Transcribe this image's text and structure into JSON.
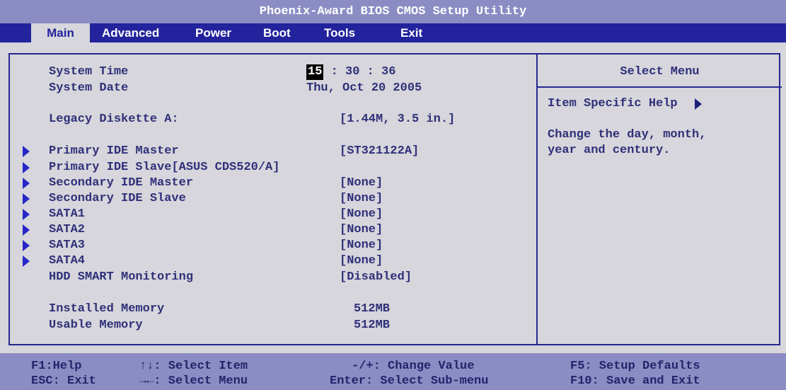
{
  "title": "Phoenix-Award BIOS CMOS Setup Utility",
  "menu": [
    "Main",
    "Advanced",
    "Power",
    "Boot",
    "Tools",
    "Exit"
  ],
  "system_time": {
    "label": "System Time",
    "hour": "15",
    "rest": ": 30 : 36"
  },
  "system_date": {
    "label": "System Date",
    "value": "Thu, Oct 20 2005"
  },
  "legacy_diskette": {
    "label": "Legacy Diskette A:",
    "value": "[1.44M, 3.5 in.]"
  },
  "primary_ide_master": {
    "label": "Primary IDE Master",
    "value": "[ST321122A]"
  },
  "primary_ide_slave": {
    "label": "Primary IDE Slave",
    "value": "[ASUS CDS520/A]"
  },
  "secondary_ide_master": {
    "label": "Secondary IDE Master",
    "value": "[None]"
  },
  "secondary_ide_slave": {
    "label": "Secondary IDE Slave",
    "value": "[None]"
  },
  "sata1": {
    "label": "SATA1",
    "value": "[None]"
  },
  "sata2": {
    "label": "SATA2",
    "value": "[None]"
  },
  "sata3": {
    "label": "SATA3",
    "value": "[None]"
  },
  "sata4": {
    "label": "SATA4",
    "value": "[None]"
  },
  "hdd_smart": {
    "label": "HDD SMART Monitoring",
    "value": "[Disabled]"
  },
  "installed_memory": {
    "label": "Installed Memory",
    "value": "512MB"
  },
  "usable_memory": {
    "label": "Usable Memory",
    "value": "512MB"
  },
  "help": {
    "header": "Select Menu",
    "subheader": "Item Specific Help",
    "line1": "Change the day, month,",
    "line2": "year and century."
  },
  "footer": {
    "f1": "F1:Help",
    "esc": "ESC: Exit",
    "arrows_ud": "↑↓: Select Item",
    "arrows_lr": "→←: Select Menu",
    "change": "-/+: Change Value",
    "enter": "Enter: Select Sub-menu",
    "f5": "F5: Setup Defaults",
    "f10": "F10: Save and Exit"
  }
}
